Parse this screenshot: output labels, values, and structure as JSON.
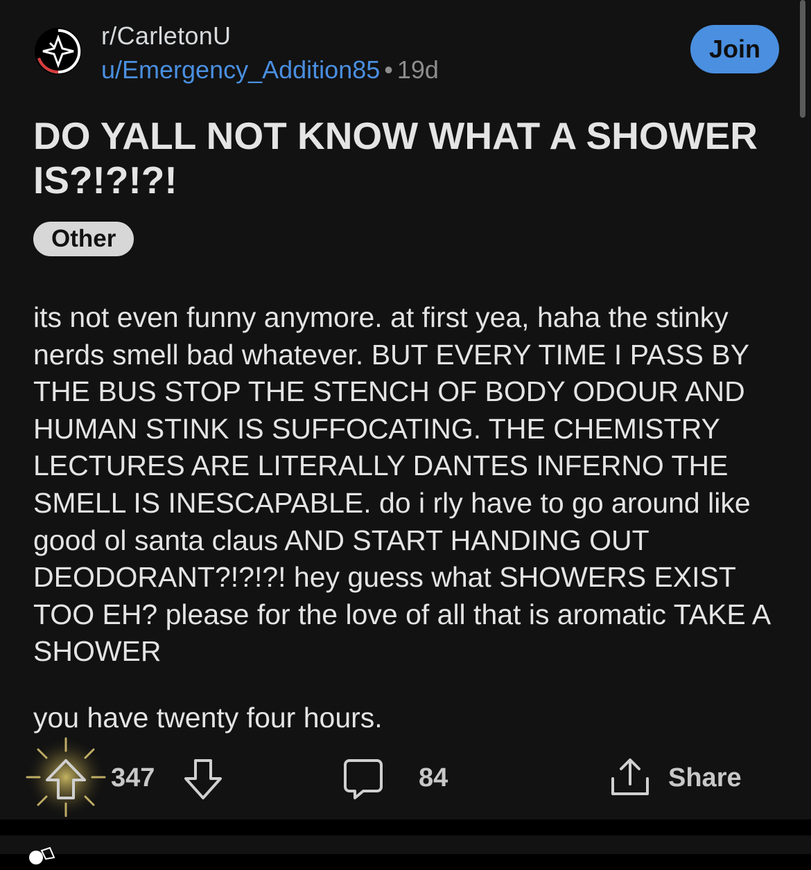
{
  "colors": {
    "background": "#121212",
    "accent_blue": "#4a8fe0",
    "text": "#e4e4e4",
    "muted": "#8d8d8d",
    "flair_bg": "#d7d7d7"
  },
  "header": {
    "subreddit": "r/CarletonU",
    "username": "u/Emergency_Addition85",
    "separator": "•",
    "age": "19d",
    "join_label": "Join",
    "avatar_icon": "subreddit-logo-icon"
  },
  "post": {
    "title": "DO YALL NOT KNOW WHAT A SHOWER IS?!?!?!",
    "flair": "Other",
    "body_paragraph_1": "its not even funny anymore. at first yea, haha the stinky nerds smell bad whatever. BUT EVERY TIME I PASS BY THE BUS STOP THE STENCH OF BODY ODOUR AND HUMAN STINK IS SUFFOCATING. THE CHEMISTRY LECTURES ARE LITERALLY DANTES INFERNO THE SMELL IS INESCAPABLE. do i rly have to go around like good ol santa claus AND START HANDING OUT DEODORANT?!?!?! hey guess what SHOWERS EXIST TOO EH? please for the love of all that is aromatic TAKE A SHOWER",
    "body_paragraph_2": "you have twenty four hours."
  },
  "actions": {
    "upvote_count": "347",
    "comment_count": "84",
    "share_label": "Share",
    "icons": [
      "upvote-icon",
      "downvote-icon",
      "comment-icon",
      "share-icon"
    ]
  }
}
